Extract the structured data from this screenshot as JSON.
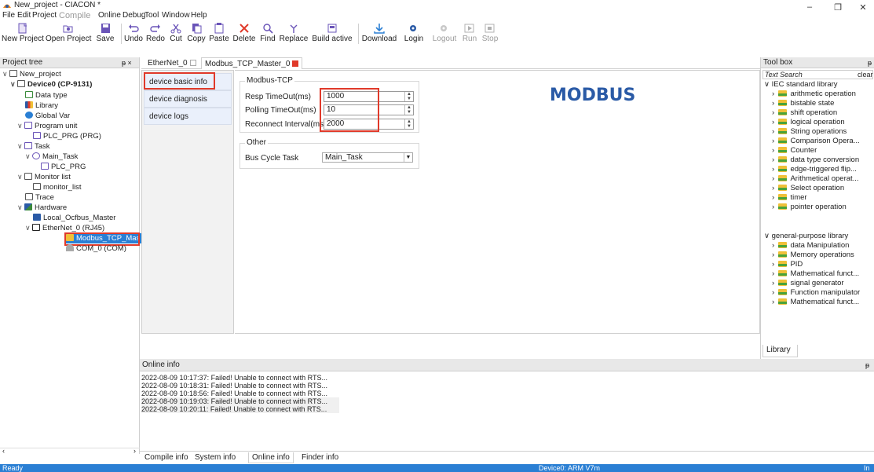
{
  "window": {
    "title": "New_project - CIACON *",
    "minimize": "–",
    "maximize": "❐",
    "close": "✕"
  },
  "menu": [
    "File",
    "Edit",
    "Project",
    "Compile",
    "Online",
    "Debug",
    "Tool",
    "Window",
    "Help"
  ],
  "toolbar": {
    "new_project": "New Project",
    "open_project": "Open Project",
    "save": "Save",
    "undo": "Undo",
    "redo": "Redo",
    "cut": "Cut",
    "copy": "Copy",
    "paste": "Paste",
    "delete": "Delete",
    "find": "Find",
    "replace": "Replace",
    "build_active": "Build active",
    "download": "Download",
    "login": "Login",
    "logout": "Logout",
    "run": "Run",
    "stop": "Stop"
  },
  "project_tree": {
    "header": "Project tree",
    "pin": "ᵽ ×",
    "nodes": {
      "new_project": "New_project",
      "device": "Device0 (CP-9131)",
      "data_type": "Data type",
      "library": "Library",
      "global_var": "Global Var",
      "program_unit": "Program unit",
      "plc_prg_prg": "PLC_PRG (PRG)",
      "task": "Task",
      "main_task": "Main_Task",
      "plc_prg": "PLC_PRG",
      "monitor_list": "Monitor list",
      "monitor_list_item": "monitor_list",
      "trace": "Trace",
      "hardware": "Hardware",
      "local_ocfbus": "Local_Ocfbus_Master",
      "ethernet": "EtherNet_0 (RJ45)",
      "modbus_tcp": "Modbus_TCP_Mas",
      "com": "COM_0 (COM)"
    }
  },
  "editor_tabs": [
    "EtherNet_0",
    "Modbus_TCP_Master_0"
  ],
  "config_nav": [
    "device basic info",
    "device diagnosis",
    "device logs"
  ],
  "modbus_tcp": {
    "group_label": "Modbus-TCP",
    "fields": [
      {
        "label": "Resp TimeOut(ms)",
        "value": "1000"
      },
      {
        "label": "Polling TimeOut(ms)",
        "value": "10"
      },
      {
        "label": "Reconnect Interval(ms",
        "value": "2000"
      }
    ],
    "logo": "MODBUS"
  },
  "other": {
    "group_label": "Other",
    "bus_cycle_label": "Bus Cycle Task",
    "bus_cycle_value": "Main_Task"
  },
  "toolbox": {
    "header": "Tool box",
    "pin": "ᵽ",
    "search_placeholder": "Text Search",
    "clear": "clear",
    "iec_label": "IEC standard library",
    "iec_items": [
      "arithmetic operation",
      "bistable state",
      "shift operation",
      "logical operation",
      "String operations",
      "Comparison Opera...",
      "Counter",
      "data type conversion",
      "edge-triggered flip...",
      "Arithmetical operat...",
      "Select operation",
      "timer",
      "pointer operation"
    ],
    "general_label": "general-purpose library",
    "general_items": [
      "data Manipulation",
      "Memory operations",
      "PID",
      "Mathematical funct...",
      "signal generator",
      "Function manipulator",
      "Mathematical funct..."
    ],
    "tab": "Library"
  },
  "online_info": {
    "header": "Online info",
    "pin": "ᵽ",
    "lines": [
      "2022-08-09 10:17:37: Failed! Unable to connect with RTS...",
      "2022-08-09 10:18:31: Failed! Unable to connect with RTS...",
      "2022-08-09 10:18:56: Failed! Unable to connect with RTS...",
      "2022-08-09 10:19:03: Failed! Unable to connect with RTS...",
      "2022-08-09 10:20:11: Failed! Unable to connect with RTS..."
    ]
  },
  "bottom_tabs": [
    "Compile info",
    "System info",
    "Online info",
    "Finder info"
  ],
  "status": {
    "left": "Ready",
    "center": "Device0: ARM V7m",
    "right": "In"
  },
  "colors": {
    "highlight_red": "#e03a2a",
    "status_blue": "#2a7fd4",
    "modbus_blue": "#2a5aa6"
  }
}
